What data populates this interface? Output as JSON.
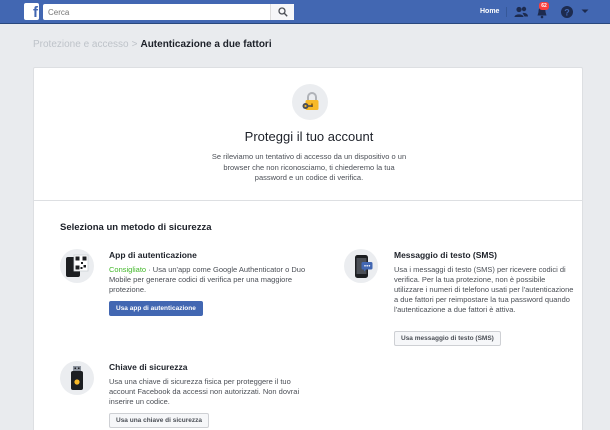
{
  "topbar": {
    "logo": "f",
    "search_placeholder": "Cerca",
    "home_label": "Home",
    "notifications_count": "62",
    "brand_color": "#4267b2"
  },
  "breadcrumb": {
    "parent": "Protezione e accesso",
    "separator": ">",
    "current": "Autenticazione a due fattori"
  },
  "hero": {
    "icon": "key-lock-icon",
    "title": "Proteggi il tuo account",
    "description": "Se rileviamo un tentativo di accesso da un dispositivo o un browser che non riconosciamo, ti chiederemo la tua password e un codice di verifica."
  },
  "methods": {
    "section_title": "Seleziona un metodo di sicurezza",
    "auth_app": {
      "icon": "qr-phone-icon",
      "title": "App di autenticazione",
      "recommended": "Consigliato",
      "description": " · Usa un'app come Google Authenticator o Duo Mobile per generare codici di verifica per una maggiore protezione.",
      "button": "Usa app di autenticazione"
    },
    "sms": {
      "icon": "sms-phone-icon",
      "title": "Messaggio di testo (SMS)",
      "description": "Usa i messaggi di testo (SMS) per ricevere codici di verifica. Per la tua protezione, non è possibile utilizzare i numeri di telefono usati per l'autenticazione a due fattori per reimpostare la tua password quando l'autenticazione a due fattori è attiva.",
      "button": "Usa messaggio di testo (SMS)"
    },
    "security_key": {
      "icon": "usb-key-icon",
      "title": "Chiave di sicurezza",
      "description": "Usa una chiave di sicurezza fisica per proteggere il tuo account Facebook da accessi non autorizzati. Non dovrai inserire un codice.",
      "button": "Usa una chiave di sicurezza"
    }
  }
}
